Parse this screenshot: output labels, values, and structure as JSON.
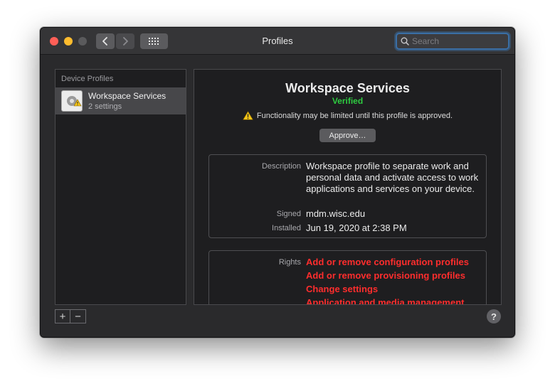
{
  "window": {
    "title": "Profiles",
    "search_placeholder": "Search"
  },
  "sidebar": {
    "header": "Device Profiles",
    "items": [
      {
        "name": "Workspace Services",
        "subtitle": "2 settings"
      }
    ]
  },
  "detail": {
    "title": "Workspace Services",
    "status": "Verified",
    "status_color": "#2ecc40",
    "warning": "Functionality may be limited until this profile is approved.",
    "approve_label": "Approve…",
    "description_label": "Description",
    "description": "Workspace profile to separate work and personal data and activate access to work applications and services on your device.",
    "signed_label": "Signed",
    "signed": "mdm.wisc.edu",
    "installed_label": "Installed",
    "installed": "Jun 19, 2020 at 2:38 PM",
    "rights_label": "Rights",
    "rights_color": "#ff2d2d",
    "rights": [
      "Add or remove configuration profiles",
      "Add or remove provisioning profiles",
      "Change settings",
      "Application and media management"
    ]
  },
  "footer": {
    "add_label": "+",
    "remove_label": "−",
    "help_label": "?"
  },
  "icons": [
    "back-chevron-icon",
    "forward-chevron-icon",
    "grid-icon",
    "search-icon",
    "warning-icon",
    "profile-icon"
  ]
}
